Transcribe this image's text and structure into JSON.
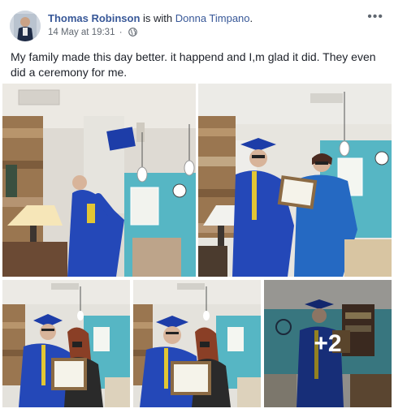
{
  "post": {
    "author": "Thomas Robinson",
    "with_text": " is with ",
    "tagged": "Donna Timpano",
    "period": ".",
    "date": "14 May at 19:31",
    "dot": "·",
    "privacy_icon": "globe-icon",
    "more_label": "•••",
    "text": "My family made this day better. it happend and I,m glad it did. They even did a ceremony for me.",
    "more_photos_label": "+2"
  },
  "colors": {
    "link": "#385898",
    "gown": "#2448b8",
    "wall": "#56b6c4",
    "wood": "#9a7650"
  }
}
